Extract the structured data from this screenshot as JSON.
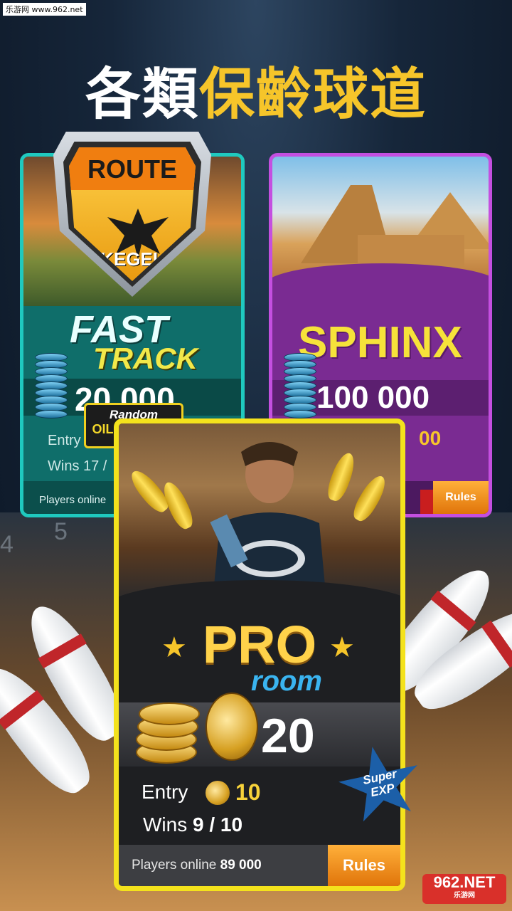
{
  "watermark": {
    "site": "乐游网 www.962.net",
    "brand": "962.NET",
    "brand_sub": "乐游网"
  },
  "headline": {
    "part1": "各類",
    "part2": "保齡球道"
  },
  "cards": {
    "fast_track": {
      "badge_top": "ROUTE",
      "badge_bottom": "KEGEL",
      "title1": "FAST",
      "title2": "TRACK",
      "prize": "20 000",
      "entry_label": "Entry",
      "wins_label": "Wins 17 /",
      "online_label": "Players online"
    },
    "sphinx": {
      "title": "SPHINX",
      "prize": "100 000",
      "entry_partial": "00",
      "rules_label": "Rules"
    },
    "oil_pattern": {
      "line1": "Random",
      "line2": "OIL PATTERN"
    },
    "pro": {
      "title": "PRO",
      "subtitle": "room",
      "prize": "20",
      "entry_label": "Entry",
      "entry_value": "10",
      "wins_label": "Wins",
      "wins_value": "9 / 10",
      "online_label": "Players online",
      "online_value": "89 000",
      "rules_label": "Rules",
      "badge_line1": "Super",
      "badge_line2": "EXP"
    }
  },
  "background": {
    "lane_numbers": [
      "4",
      "5"
    ]
  },
  "colors": {
    "teal_border": "#1fc9bf",
    "purple_border": "#c44fe0",
    "pro_border": "#f4e21c",
    "gold": "#f6c52a",
    "rules_orange": "#f08a1a"
  }
}
